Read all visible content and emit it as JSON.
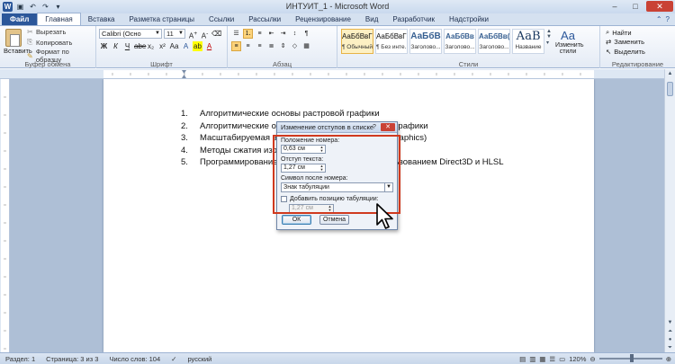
{
  "titlebar": {
    "title": "ИНТУИТ_1 - Microsoft Word",
    "word_logo": "W",
    "controls": [
      "–",
      "□",
      "✕"
    ]
  },
  "tabs": [
    {
      "label": "Файл",
      "kind": "file"
    },
    {
      "label": "Главная",
      "kind": "active"
    },
    {
      "label": "Вставка"
    },
    {
      "label": "Разметка страницы"
    },
    {
      "label": "Ссылки"
    },
    {
      "label": "Рассылки"
    },
    {
      "label": "Рецензирование"
    },
    {
      "label": "Вид"
    },
    {
      "label": "Разработчик"
    },
    {
      "label": "Надстройки"
    }
  ],
  "ribbon": {
    "clipboard": {
      "paste": "Вставить",
      "cut": "Вырезать",
      "copy": "Копировать",
      "format_painter": "Формат по образцу",
      "group": "Буфер обмена"
    },
    "font": {
      "name": "Calibri (Осно",
      "size": "11",
      "group": "Шрифт"
    },
    "paragraph": {
      "group": "Абзац"
    },
    "styles": {
      "group": "Стили",
      "tiles": [
        {
          "preview": "АаБбВвГг,",
          "name": "¶ Обычный"
        },
        {
          "preview": "АаБбВвГг,",
          "name": "¶ Без инте..."
        },
        {
          "preview": "АаБбВ",
          "name": "Заголово..."
        },
        {
          "preview": "АаБбВв",
          "name": "Заголово..."
        },
        {
          "preview": "АаБбВв(",
          "name": "Заголово..."
        },
        {
          "preview": "АаВ",
          "name": "Название"
        }
      ],
      "change_styles": "Изменить стили"
    },
    "editing": {
      "find": "Найти",
      "replace": "Заменить",
      "select": "Выделить",
      "group": "Редактирование"
    }
  },
  "document": {
    "items": [
      {
        "num": "1.",
        "text": "Алгоритмические основы растровой графики"
      },
      {
        "num": "2.",
        "text": "Алгоритмические ос",
        "tail": "й графики"
      },
      {
        "num": "3.",
        "text": "Масштабируемая в",
        "tail": "Graphics)"
      },
      {
        "num": "4.",
        "text": "Методы сжатия изо"
      },
      {
        "num": "5.",
        "text": "Программирование",
        "tail": "льзованием Direct3D и HLSL"
      }
    ]
  },
  "dialog": {
    "title": "Изменение отступов в списке",
    "help": "?",
    "close": "✕",
    "number_position_label": "Положение номера:",
    "number_position_value": "0,63 см",
    "text_indent_label": "Отступ текста:",
    "text_indent_value": "1,27 см",
    "follow_label": "Символ после номера:",
    "follow_value": "Знак табуляции",
    "add_tab_label": "Добавить позицию табуляции:",
    "add_tab_value": "1,27 см",
    "ok": "ОК",
    "cancel": "Отмена"
  },
  "statusbar": {
    "section": "Раздел: 1",
    "page": "Страница: 3 из 3",
    "words": "Число слов: 104",
    "language": "русский",
    "zoom": "120%",
    "zoom_level": 120
  }
}
